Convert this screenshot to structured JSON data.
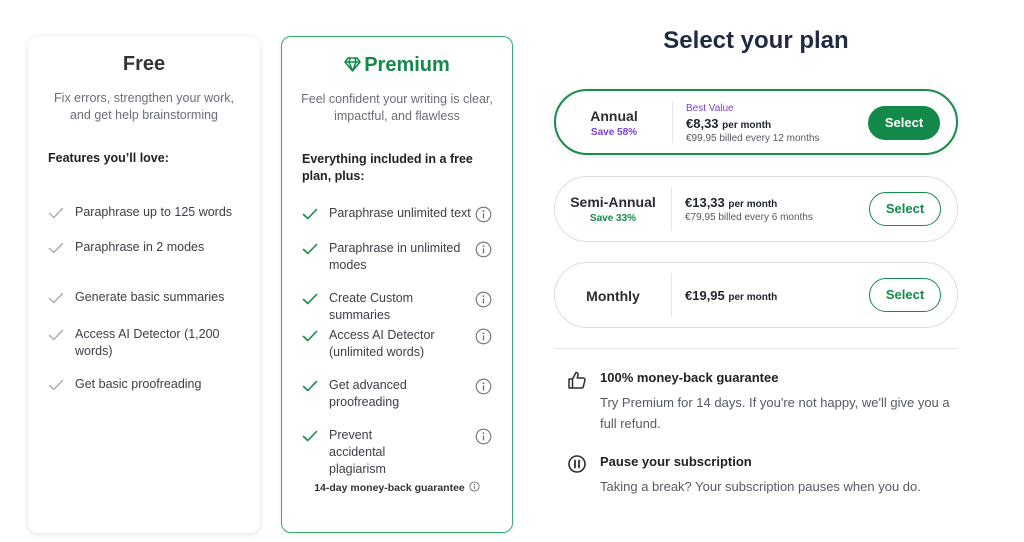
{
  "free": {
    "title": "Free",
    "description": "Fix errors, strengthen your work, and get help brainstorming",
    "subheading": "Features you’ll love:",
    "features": [
      "Paraphrase up to 125 words",
      "Paraphrase in 2 modes",
      "Generate basic summaries",
      "Access AI Detector (1,200 words)",
      "Get basic proofreading"
    ]
  },
  "premium": {
    "title": "Premium",
    "title_icon": "diamond-icon",
    "description": "Feel confident your writing is clear, impactful, and flawless",
    "subheading": "Everything included in a free plan, plus:",
    "features": [
      "Paraphrase unlimited text",
      "Paraphrase in unlimited modes",
      "Create Custom summaries",
      "Access AI Detector (unlimited words)",
      "Get advanced proofreading",
      "Prevent accidental plagiarism"
    ],
    "guarantee": "14-day money-back guarantee"
  },
  "heading": "Select your plan",
  "plans": [
    {
      "name": "Annual",
      "save": "Save 58%",
      "badge": "Best Value",
      "price": "€8,33",
      "per": "per month",
      "billed": "€99,95 billed every 12 months",
      "button": "Select",
      "selected": true
    },
    {
      "name": "Semi-Annual",
      "save": "Save 33%",
      "price": "€13,33",
      "per": "per month",
      "billed": "€79,95 billed every 6 months",
      "button": "Select",
      "selected": false
    },
    {
      "name": "Monthly",
      "price": "€19,95",
      "per": "per month",
      "button": "Select",
      "selected": false
    }
  ],
  "benefits": [
    {
      "icon": "thumbs-up-icon",
      "title": "100% money-back guarantee",
      "text": "Try Premium for 14 days. If you're not happy, we'll give you a full refund."
    },
    {
      "icon": "pause-icon",
      "title": "Pause your subscription",
      "text": "Taking a break? Your subscription pauses when you do."
    }
  ],
  "colors": {
    "brand_green": "#138a4a",
    "accent_purple": "#7b3fd0",
    "heading_navy": "#1f2a44"
  }
}
